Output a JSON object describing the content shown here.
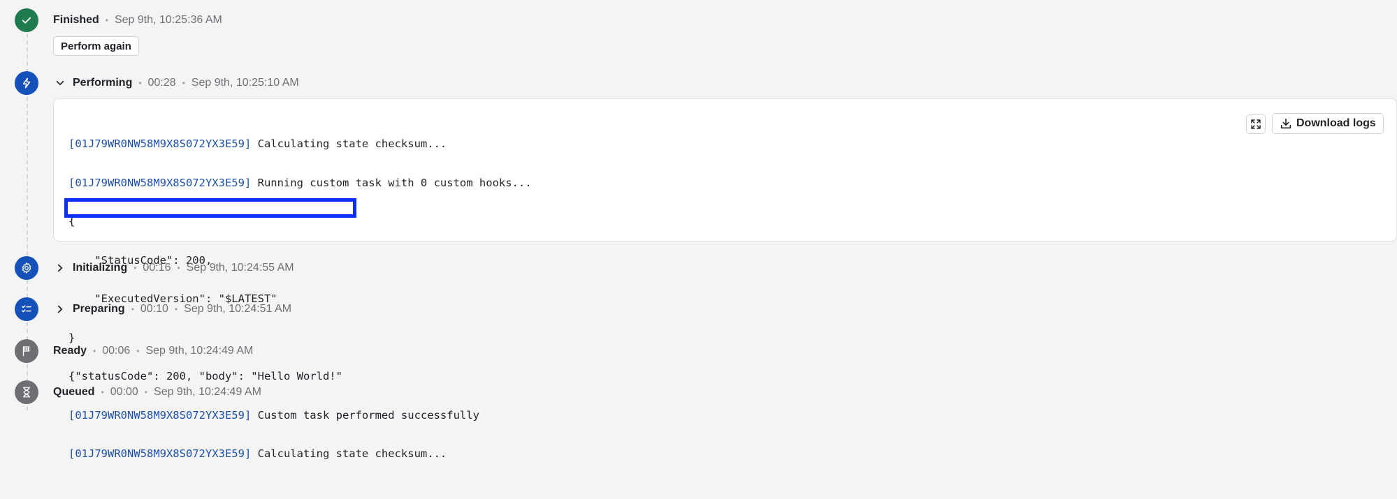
{
  "steps": {
    "finished": {
      "title": "Finished",
      "timestamp": "Sep 9th, 10:25:36 AM",
      "action_label": "Perform again"
    },
    "performing": {
      "title": "Performing",
      "duration": "00:28",
      "timestamp": "Sep 9th, 10:25:10 AM",
      "expanded": true
    },
    "initializing": {
      "title": "Initializing",
      "duration": "00:16",
      "timestamp": "Sep 9th, 10:24:55 AM",
      "expanded": false
    },
    "preparing": {
      "title": "Preparing",
      "duration": "00:10",
      "timestamp": "Sep 9th, 10:24:51 AM",
      "expanded": false
    },
    "ready": {
      "title": "Ready",
      "duration": "00:06",
      "timestamp": "Sep 9th, 10:24:49 AM"
    },
    "queued": {
      "title": "Queued",
      "duration": "00:00",
      "timestamp": "Sep 9th, 10:24:49 AM"
    }
  },
  "separator": "•",
  "logs": {
    "download_label": "Download logs",
    "lines": [
      {
        "id": "[01J79WR0NW58M9X8S072YX3E59]",
        "text": " Calculating state checksum..."
      },
      {
        "id": "[01J79WR0NW58M9X8S072YX3E59]",
        "text": " Running custom task with 0 custom hooks..."
      },
      {
        "id": "",
        "text": "{"
      },
      {
        "id": "",
        "text": "    \"StatusCode\": 200,"
      },
      {
        "id": "",
        "text": "    \"ExecutedVersion\": \"$LATEST\""
      },
      {
        "id": "",
        "text": "}"
      },
      {
        "id": "",
        "text": "{\"statusCode\": 200, \"body\": \"Hello World!\""
      },
      {
        "id": "[01J79WR0NW58M9X8S072YX3E59]",
        "text": " Custom task performed successfully"
      },
      {
        "id": "[01J79WR0NW58M9X8S072YX3E59]",
        "text": " Calculating state checksum..."
      }
    ]
  },
  "colors": {
    "finished_icon": "#1f7a4d",
    "active_icon": "#1451b8",
    "inactive_icon": "#6d6f73",
    "log_id": "#1c4fa6",
    "highlight_box": "#0b2ff5"
  },
  "icons": {
    "finished": "check-icon",
    "performing": "lightning-icon",
    "initializing": "gear-icon",
    "preparing": "checklist-icon",
    "ready": "flag-icon",
    "queued": "hourglass-icon"
  }
}
